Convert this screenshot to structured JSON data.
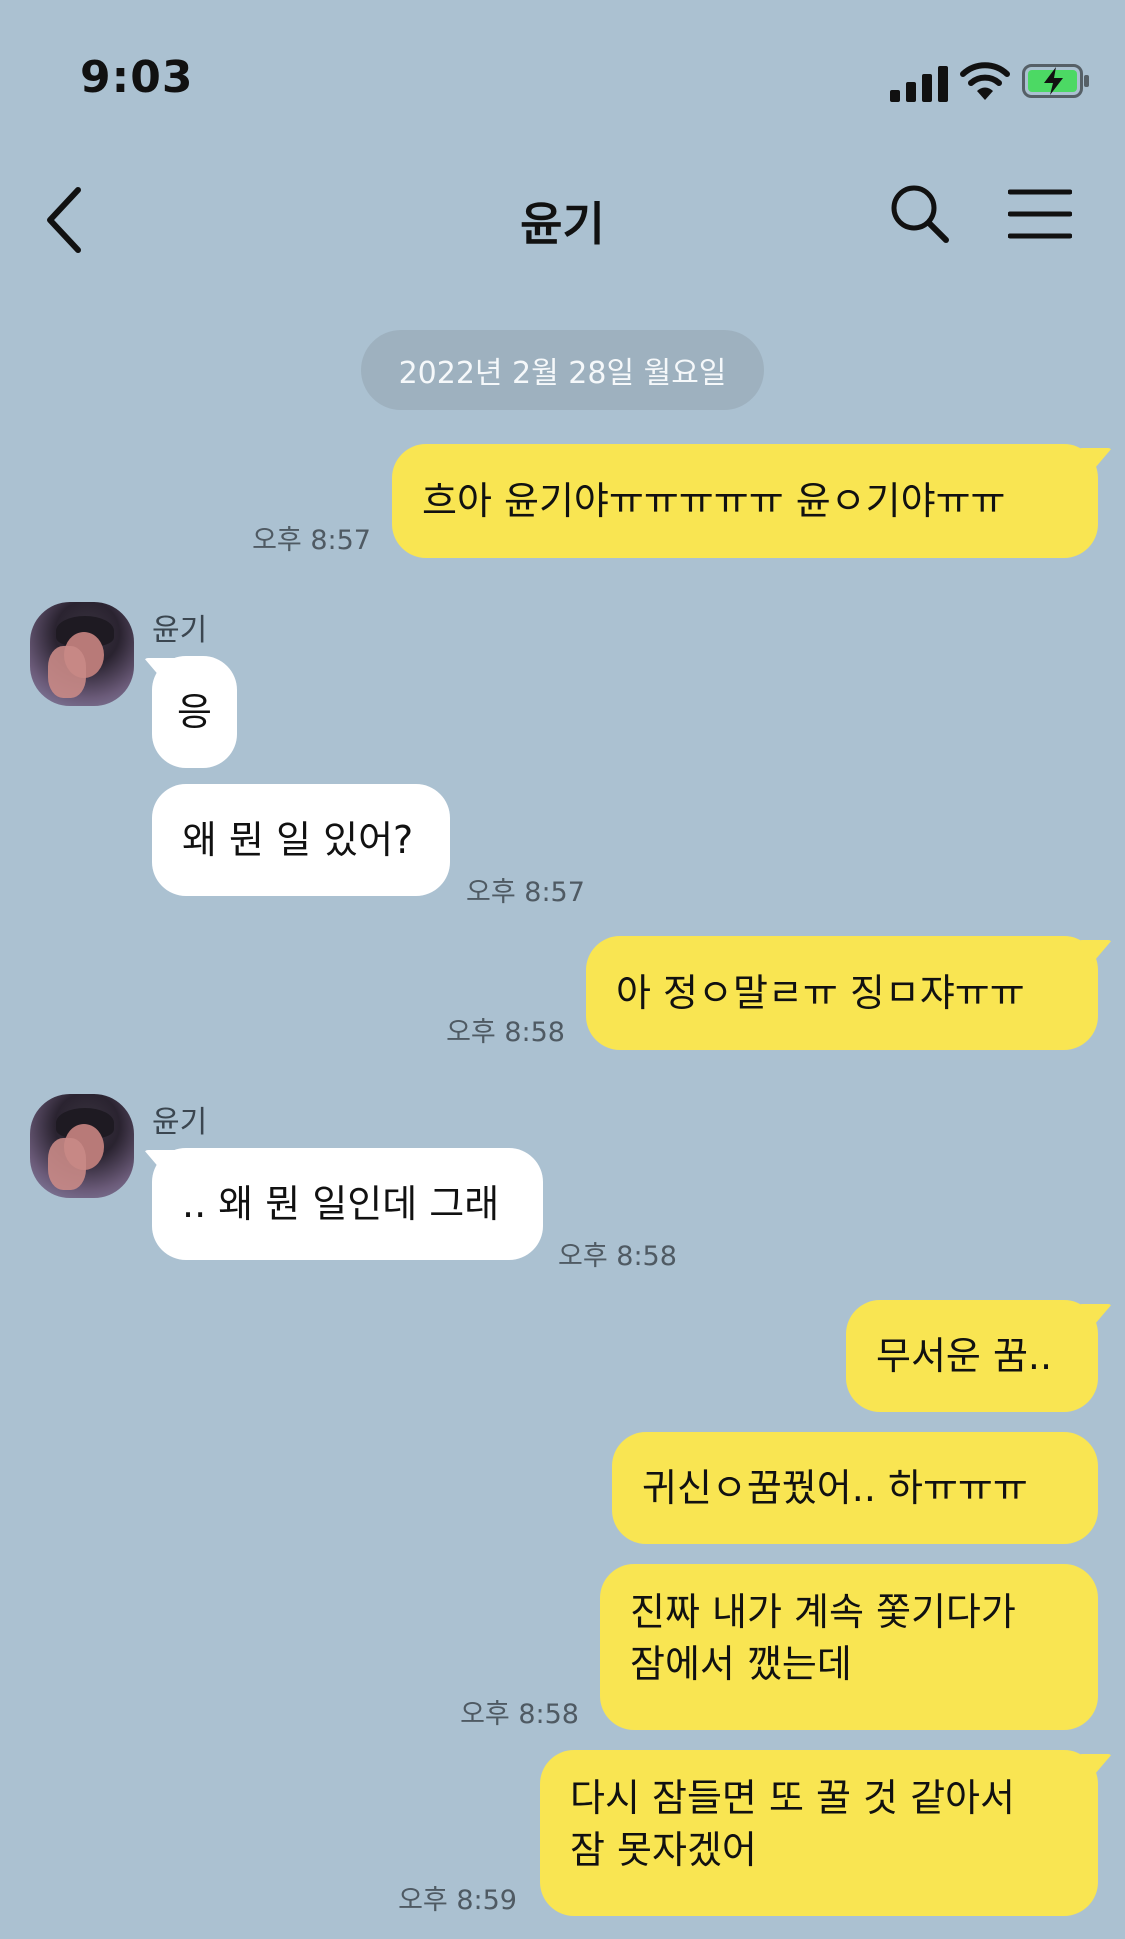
{
  "status_bar": {
    "time": "9:03"
  },
  "header": {
    "title": "윤기"
  },
  "date_divider": "2022년 2월 28일 월요일",
  "messages": [
    {
      "text": "흐아 윤기야ㅠㅠㅠㅠㅠ 윤ㅇ기야ㅠㅠ",
      "time": "오후 8:57"
    },
    {
      "sender": "윤기",
      "text": "응"
    },
    {
      "text": "왜 뭔 일 있어?",
      "time": "오후 8:57"
    },
    {
      "text": "아 정ㅇ말ㄹㅠ 징ㅁ쟈ㅠㅠ",
      "time": "오후 8:58"
    },
    {
      "sender": "윤기",
      "text": ".. 왜 뭔 일인데 그래",
      "time": "오후 8:58"
    },
    {
      "text": "무서운 꿈.."
    },
    {
      "text": "귀신ㅇ꿈꿨어.. 하ㅠㅠㅠ"
    },
    {
      "line1": "진짜 내가 계속 쫓기다가",
      "line2": "잠에서 깼는데",
      "time": "오후 8:58"
    },
    {
      "line1": "다시 잠들면 또 꿀 것 같아서",
      "line2": "잠 못자겠어",
      "time": "오후 8:59"
    }
  ],
  "colors": {
    "background": "#abc1d1",
    "my_bubble": "#f9e552",
    "their_bubble": "#ffffff",
    "battery_fill": "#4cd964"
  },
  "icons": [
    "back-arrow-icon",
    "search-icon",
    "menu-icon",
    "signal-icon",
    "wifi-icon",
    "battery-charging-icon"
  ]
}
